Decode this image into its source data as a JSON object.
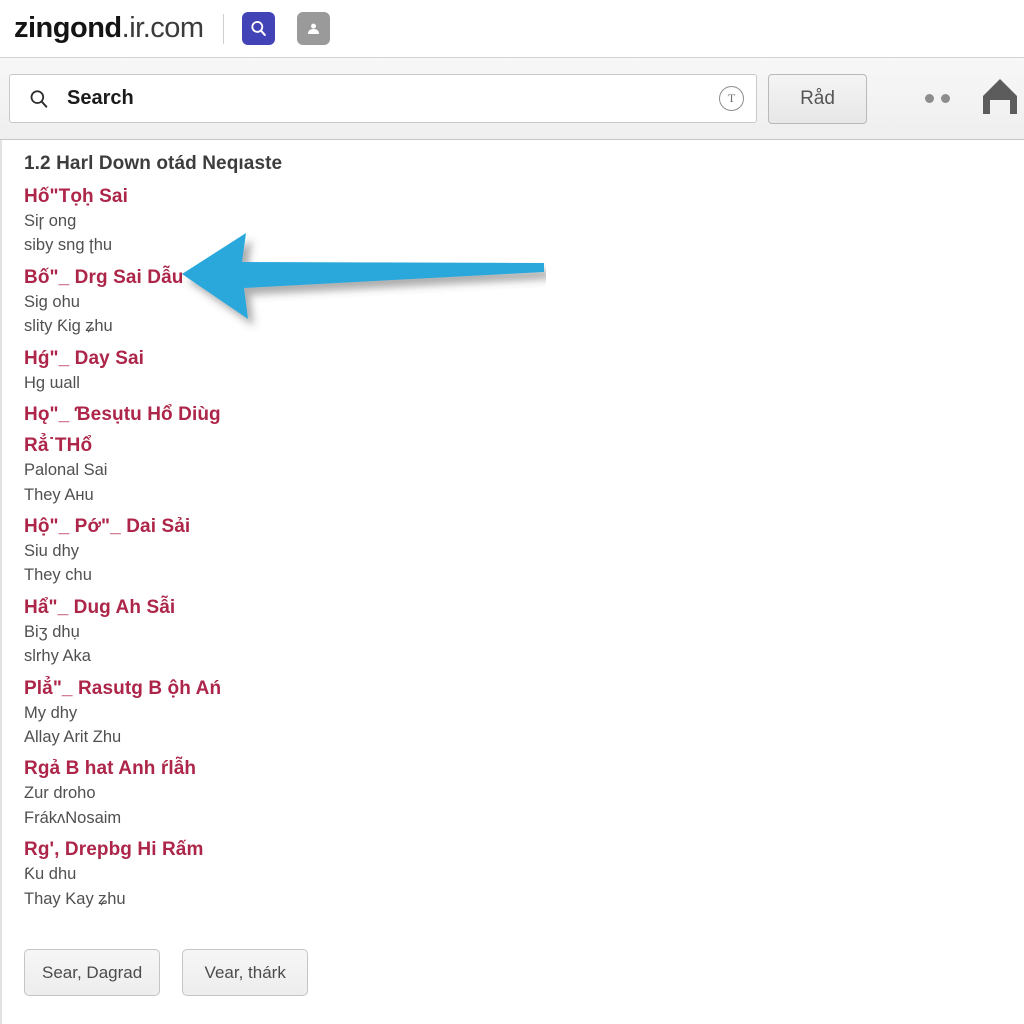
{
  "brand": {
    "logo_main": "zingond",
    "logo_tld": ".ir.com",
    "search_button_icon": "search-icon",
    "inbox_button_icon": "inbox-person-icon"
  },
  "toolbar": {
    "search_icon": "search-icon",
    "search_value": "Search",
    "search_placeholder": "Search",
    "field_glyph": "T",
    "rad_button_label": "Råd",
    "overflow_icon": "more-dots-icon",
    "home_icon": "home-icon"
  },
  "content": {
    "section_title": "1.2 Harl Down otád Neqıaste",
    "entries": [
      {
        "heading": "Hố\"Tọḥ Sai",
        "lines": [
          "Siɼ ong",
          "siby sng ʈhu"
        ]
      },
      {
        "heading": "Bố\"_ Drg Sai Dẫu",
        "lines": [
          "Siɡ ohu",
          "slity Ƙiɡ ʑhu"
        ]
      },
      {
        "heading": "Hǵ\"_ Day Sai",
        "lines": [
          "Hɡ ɯall"
        ]
      },
      {
        "heading": "Hǫ\"_ Ɓesụtu Hổ Diùg",
        "lines": []
      },
      {
        "heading": "Rẳ˙THổ",
        "lines": [
          "Palonal Sai",
          "They Aʜu"
        ]
      },
      {
        "heading": "Hộ\"_ Pớ\"_ Dai Sải",
        "lines": [
          "Siu dhy",
          "They chu"
        ]
      },
      {
        "heading": "Hẩ\"_ Dug Ah Sẫi",
        "lines": [
          "Biʒ dhụ",
          "slrhy Aka"
        ]
      },
      {
        "heading": "Plẳ\"_ Rasutg B ộh Ań",
        "lines": [
          "My dhy",
          "Allay Arit Zhu"
        ]
      },
      {
        "heading": "Rgả B hat Anh ŕlẫh",
        "lines": [
          "Zur droho",
          "FrákʌNosaim"
        ]
      },
      {
        "heading": "Rg', Drepbg Hi Rấm",
        "lines": [
          "Ƙu dhu",
          "Thay Kay ʑhu"
        ]
      }
    ],
    "buttons": [
      {
        "label": "Sear, Dagrad"
      },
      {
        "label": "Vear, thárk"
      }
    ]
  },
  "annotation": {
    "arrow_icon": "left-arrow-annotation",
    "arrow_color": "#29a8dc",
    "arrow_direction": "left"
  },
  "colors": {
    "heading_red": "#ad2649",
    "brand_blue": "#4343b8",
    "arrow_blue": "#29a8dc",
    "toolbar_gray": "#f1f1f1"
  }
}
